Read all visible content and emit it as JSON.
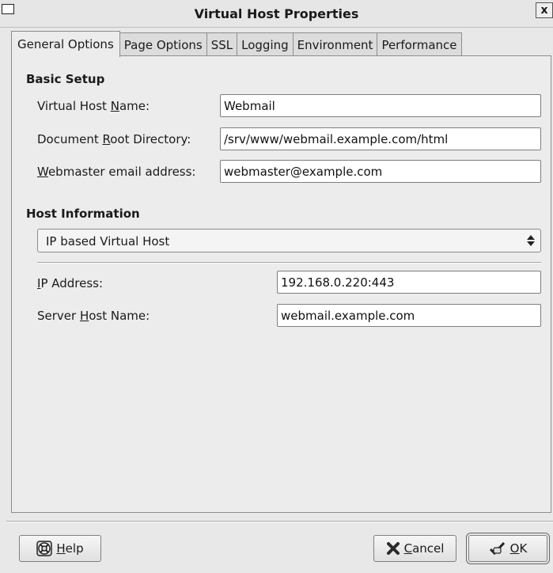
{
  "window": {
    "title": "Virtual Host Properties",
    "close_glyph": "x"
  },
  "tabs": [
    {
      "label": "General Options",
      "active": true
    },
    {
      "label": "Page Options"
    },
    {
      "label": "SSL"
    },
    {
      "label": "Logging"
    },
    {
      "label": "Environment"
    },
    {
      "label": "Performance"
    }
  ],
  "basic_setup": {
    "heading": "Basic Setup",
    "vhost_name": {
      "pre": "Virtual Host ",
      "mnemonic": "N",
      "post": "ame:",
      "value": "Webmail"
    },
    "doc_root": {
      "pre": "Document ",
      "mnemonic": "R",
      "post": "oot Directory:",
      "value": "/srv/www/webmail.example.com/html"
    },
    "webmaster": {
      "pre": "",
      "mnemonic": "W",
      "post": "ebmaster email address:",
      "value": "webmaster@example.com"
    }
  },
  "host_info": {
    "heading": "Host Information",
    "host_type": {
      "selected": "IP based Virtual Host",
      "icon": "updown-arrows-icon"
    },
    "ip_address": {
      "pre": "",
      "mnemonic": "I",
      "post": "P Address:",
      "value": "192.168.0.220:443"
    },
    "server_host": {
      "pre": "Server ",
      "mnemonic": "H",
      "post": "ost Name:",
      "value": "webmail.example.com"
    }
  },
  "buttons": {
    "help": {
      "mnemonic": "H",
      "post": "elp",
      "icon": "lifebuoy-icon"
    },
    "cancel": {
      "mnemonic": "C",
      "post": "ancel",
      "icon": "cross-icon"
    },
    "ok": {
      "mnemonic": "O",
      "post": "K",
      "icon": "checkmark-hand-icon"
    }
  },
  "colors": {
    "cancel_icon": "#2a2a2a"
  }
}
